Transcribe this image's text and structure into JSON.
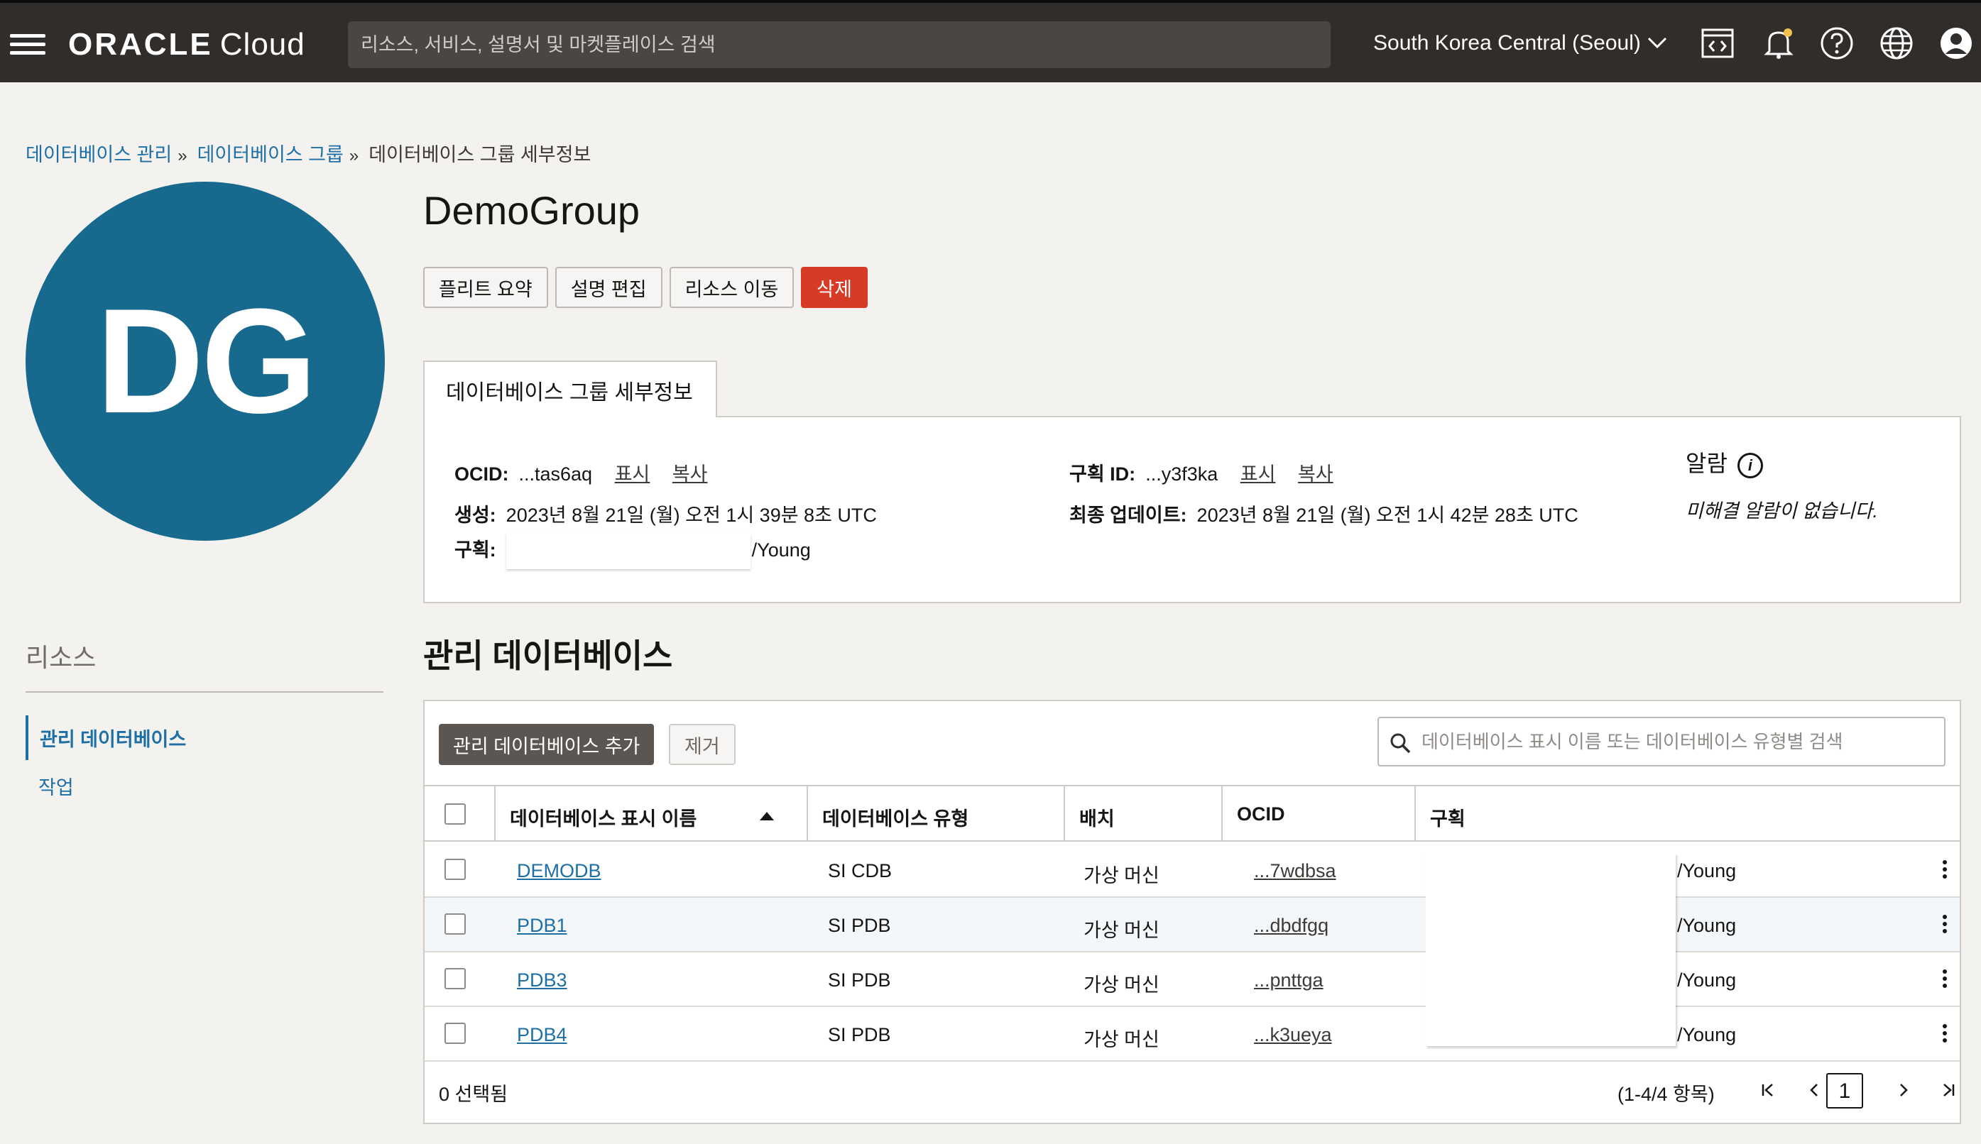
{
  "header": {
    "logo_brand": "ORACLE",
    "logo_product": "Cloud",
    "search_placeholder": "리소스, 서비스, 설명서 및 마켓플레이스 검색",
    "region": "South Korea Central (Seoul)"
  },
  "breadcrumb": {
    "items": [
      "데이터베이스 관리",
      "데이터베이스 그룹"
    ],
    "separator": "»",
    "current": "데이터베이스 그룹 세부정보"
  },
  "avatar": {
    "initials": "DG"
  },
  "page_title": "DemoGroup",
  "actions": {
    "fleet_summary": "플리트 요약",
    "edit_description": "설명 편집",
    "move_resource": "리소스 이동",
    "delete": "삭제"
  },
  "details": {
    "tab_label": "데이터베이스 그룹 세부정보",
    "ocid_label": "OCID:",
    "ocid_value": "...tas6aq",
    "show": "표시",
    "copy": "복사",
    "created_label": "생성:",
    "created_value": "2023년 8월 21일 (월) 오전 1시 39분 8초 UTC",
    "compartment_label": "구획:",
    "compartment_value": "/Young",
    "compartment_id_label": "구획 ID:",
    "compartment_id_value": "...y3f3ka",
    "updated_label": "최종 업데이트:",
    "updated_value": "2023년 8월 21일 (월) 오전 1시 42분 28초 UTC",
    "alarm_title": "알람",
    "alarm_message": "미해결 알람이 없습니다."
  },
  "resources": {
    "title": "리소스",
    "items": [
      "관리 데이터베이스",
      "작업"
    ]
  },
  "section_title": "관리 데이터베이스",
  "table": {
    "add_button": "관리 데이터베이스 추가",
    "remove_button": "제거",
    "search_placeholder": "데이터베이스 표시 이름 또는 데이터베이스 유형별 검색",
    "columns": [
      "데이터베이스 표시 이름",
      "데이터베이스 유형",
      "배치",
      "OCID",
      "구획"
    ],
    "rows": [
      {
        "name": "DEMODB",
        "type": "SI CDB",
        "deployment": "가상 머신",
        "ocid": "...7wdbsa",
        "compartment": "/Young"
      },
      {
        "name": "PDB1",
        "type": "SI PDB",
        "deployment": "가상 머신",
        "ocid": "...dbdfgq",
        "compartment": "/Young"
      },
      {
        "name": "PDB3",
        "type": "SI PDB",
        "deployment": "가상 머신",
        "ocid": "...pnttga",
        "compartment": "/Young"
      },
      {
        "name": "PDB4",
        "type": "SI PDB",
        "deployment": "가상 머신",
        "ocid": "...k3ueya",
        "compartment": "/Young"
      }
    ],
    "selected_count": "0 선택됨",
    "page_info": "(1-4/4 항목)",
    "current_page": "1"
  }
}
